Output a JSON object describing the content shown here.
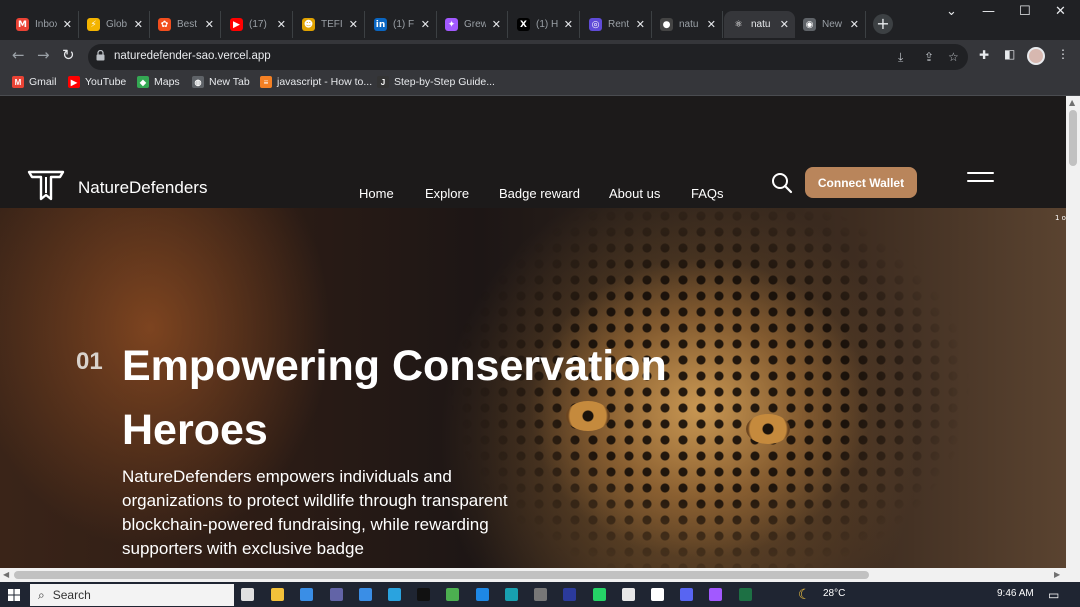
{
  "tabs": [
    {
      "title": "Inbox",
      "icon": "gmail-icon",
      "color": "#ea4335",
      "glyph": "M"
    },
    {
      "title": "Glob",
      "icon": "bolt-icon",
      "color": "#f4b400",
      "glyph": "⚡"
    },
    {
      "title": "Best",
      "icon": "figma-icon",
      "color": "#f24e1e",
      "glyph": "✿"
    },
    {
      "title": "(17)",
      "icon": "youtube-icon",
      "color": "#ff0000",
      "glyph": "▶"
    },
    {
      "title": "TEFI",
      "icon": "tefi-icon",
      "color": "#e0a200",
      "glyph": "☻"
    },
    {
      "title": "(1) F",
      "icon": "linkedin-icon",
      "color": "#0a66c2",
      "glyph": "in"
    },
    {
      "title": "Grew",
      "icon": "figma-icon",
      "color": "#a259ff",
      "glyph": "✦"
    },
    {
      "title": "(1) H",
      "icon": "x-icon",
      "color": "#000000",
      "glyph": "X"
    },
    {
      "title": "Rent",
      "icon": "rent-icon",
      "color": "#5f4bd8",
      "glyph": "◎"
    },
    {
      "title": "natu",
      "icon": "github-icon",
      "color": "#444444",
      "glyph": "●"
    },
    {
      "title": "natu",
      "icon": "react-icon",
      "color": "#35363a",
      "glyph": "⚛"
    },
    {
      "title": "New",
      "icon": "chrome-icon",
      "color": "#5f6368",
      "glyph": "◉"
    }
  ],
  "omnibox": {
    "url": "naturedefender-sao.vercel.app"
  },
  "bookmarks": [
    {
      "label": "Gmail",
      "icon": "gmail-icon",
      "color": "#ea4335",
      "glyph": "M"
    },
    {
      "label": "YouTube",
      "icon": "youtube-icon",
      "color": "#ff0000",
      "glyph": "▶"
    },
    {
      "label": "Maps",
      "icon": "maps-icon",
      "color": "#34a853",
      "glyph": "◆"
    },
    {
      "label": "New Tab",
      "icon": "globe-icon",
      "color": "#5f6368",
      "glyph": "◍"
    },
    {
      "label": "javascript - How to...",
      "icon": "stackoverflow-icon",
      "color": "#f48024",
      "glyph": "≡"
    },
    {
      "label": "Step-by-Step Guide...",
      "icon": "doc-icon",
      "color": "#333333",
      "glyph": "J"
    }
  ],
  "site": {
    "brand": "NatureDefenders",
    "nav": [
      "Home",
      "Explore",
      "Badge reward",
      "About us",
      "FAQs"
    ],
    "connect_label": "Connect Wallet",
    "slide_number": "01",
    "hero_title": "Empowering Conservation Heroes",
    "hero_description": "NatureDefenders empowers individuals and organizations to protect wildlife through transparent blockchain-powered fundraising, while rewarding supporters with exclusive badge",
    "corner_text": "1 o"
  },
  "taskbar": {
    "search_label": "Search",
    "weather": "28°C",
    "time": "9:46 AM"
  },
  "colors": {
    "accent": "#b9855b",
    "chrome_bg": "#202124",
    "toolbar_bg": "#35363a",
    "page_bg": "#1c1a1a"
  }
}
